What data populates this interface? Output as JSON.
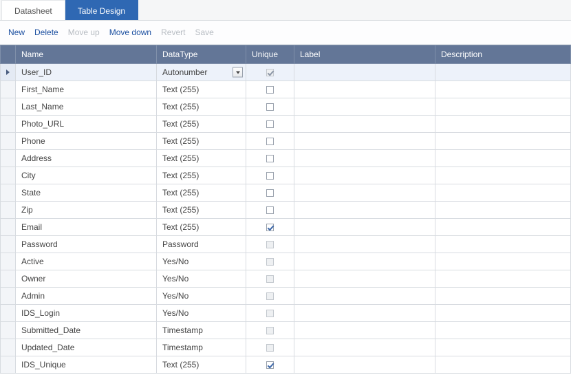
{
  "tabs": {
    "datasheet": "Datasheet",
    "tabledesign": "Table Design",
    "active_index": 1
  },
  "toolbar": {
    "new": "New",
    "delete": "Delete",
    "moveup": "Move up",
    "movedown": "Move down",
    "revert": "Revert",
    "save": "Save"
  },
  "columns": {
    "name": "Name",
    "datatype": "DataType",
    "unique": "Unique",
    "label": "Label",
    "description": "Description"
  },
  "selected_row": 0,
  "rows": [
    {
      "name": "User_ID",
      "datatype": "Autonumber",
      "unique": true,
      "unique_disabled": true,
      "label": "",
      "description": "",
      "show_dropdown": true
    },
    {
      "name": "First_Name",
      "datatype": "Text (255)",
      "unique": false,
      "unique_disabled": false,
      "label": "",
      "description": ""
    },
    {
      "name": "Last_Name",
      "datatype": "Text (255)",
      "unique": false,
      "unique_disabled": false,
      "label": "",
      "description": ""
    },
    {
      "name": "Photo_URL",
      "datatype": "Text (255)",
      "unique": false,
      "unique_disabled": false,
      "label": "",
      "description": ""
    },
    {
      "name": "Phone",
      "datatype": "Text (255)",
      "unique": false,
      "unique_disabled": false,
      "label": "",
      "description": ""
    },
    {
      "name": "Address",
      "datatype": "Text (255)",
      "unique": false,
      "unique_disabled": false,
      "label": "",
      "description": ""
    },
    {
      "name": "City",
      "datatype": "Text (255)",
      "unique": false,
      "unique_disabled": false,
      "label": "",
      "description": ""
    },
    {
      "name": "State",
      "datatype": "Text (255)",
      "unique": false,
      "unique_disabled": false,
      "label": "",
      "description": ""
    },
    {
      "name": "Zip",
      "datatype": "Text (255)",
      "unique": false,
      "unique_disabled": false,
      "label": "",
      "description": ""
    },
    {
      "name": "Email",
      "datatype": "Text (255)",
      "unique": true,
      "unique_disabled": false,
      "label": "",
      "description": ""
    },
    {
      "name": "Password",
      "datatype": "Password",
      "unique": false,
      "unique_disabled": true,
      "label": "",
      "description": ""
    },
    {
      "name": "Active",
      "datatype": "Yes/No",
      "unique": false,
      "unique_disabled": true,
      "label": "",
      "description": ""
    },
    {
      "name": "Owner",
      "datatype": "Yes/No",
      "unique": false,
      "unique_disabled": true,
      "label": "",
      "description": ""
    },
    {
      "name": "Admin",
      "datatype": "Yes/No",
      "unique": false,
      "unique_disabled": true,
      "label": "",
      "description": ""
    },
    {
      "name": "IDS_Login",
      "datatype": "Yes/No",
      "unique": false,
      "unique_disabled": true,
      "label": "",
      "description": ""
    },
    {
      "name": "Submitted_Date",
      "datatype": "Timestamp",
      "unique": false,
      "unique_disabled": true,
      "label": "",
      "description": ""
    },
    {
      "name": "Updated_Date",
      "datatype": "Timestamp",
      "unique": false,
      "unique_disabled": true,
      "label": "",
      "description": ""
    },
    {
      "name": "IDS_Unique",
      "datatype": "Text (255)",
      "unique": true,
      "unique_disabled": false,
      "label": "",
      "description": ""
    }
  ]
}
